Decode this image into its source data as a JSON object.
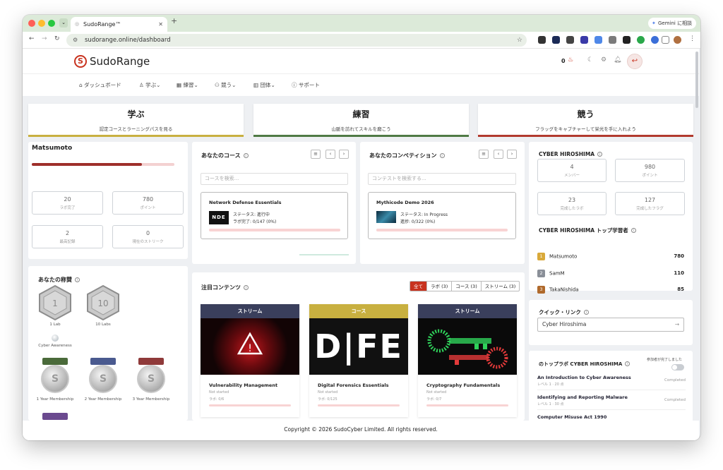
{
  "browser": {
    "tab_title": "SudoRange™",
    "url": "sudorange.online/dashboard",
    "gemini_button": "Gemini に相談"
  },
  "site": {
    "logo_text": "SudoRange",
    "streak_count": "0"
  },
  "nav": {
    "dashboard": "ダッシュボード",
    "learn": "学ぶ",
    "practice": "練習",
    "compete": "競う",
    "team": "団体",
    "support": "サポート"
  },
  "hero": [
    {
      "title": "学ぶ",
      "subtitle": "認定コースとラーニングパスを見る",
      "color": "#c8b040"
    },
    {
      "title": "練習",
      "subtitle": "山脈を訪れてスキルを磨こう",
      "color": "#4f7a45"
    },
    {
      "title": "競う",
      "subtitle": "フラッグをキャプチャーして栄光を手に入れよう",
      "color": "#b23a2e"
    }
  ],
  "profile": {
    "name": "Matsumoto",
    "level_progress": 0.77,
    "stats": [
      {
        "value": "20",
        "label": "ラボ完了"
      },
      {
        "value": "780",
        "label": "ポイント"
      },
      {
        "value": "2",
        "label": "最高記録"
      },
      {
        "value": "0",
        "label": "現在のストリーク"
      }
    ]
  },
  "courses": {
    "title": "あなたのコース",
    "search_placeholder": "コースを検索...",
    "item": {
      "name": "Network Defense Essentials",
      "logo_text": "NDE",
      "status": "ステータス: 進行中",
      "labs": "ラボ完了: 0/147 (0%)",
      "progress": 0
    }
  },
  "competitions": {
    "title": "あなたのコンペティション",
    "search_placeholder": "コンテストを検索する...",
    "item": {
      "name": "Mythicode Demo 2026",
      "status": "ステータス: In Progress",
      "progress_text": "進捗: 0/322 (0%)",
      "progress": 0
    }
  },
  "team": {
    "name": "CYBER HIROSHIMA",
    "stats": [
      {
        "value": "4",
        "label": "メンバー"
      },
      {
        "value": "980",
        "label": "ポイント"
      },
      {
        "value": "23",
        "label": "完成したラボ"
      },
      {
        "value": "127",
        "label": "完成したフラグ"
      }
    ],
    "leaderboard_title": "CYBER HIROSHIMA トップ学習者",
    "leaders": [
      {
        "rank": "1",
        "name": "Matsumoto",
        "points": "780",
        "color": "#d9a93a"
      },
      {
        "rank": "2",
        "name": "SamM",
        "points": "110",
        "color": "#8a8f98"
      },
      {
        "rank": "3",
        "name": "TakaNishida",
        "points": "85",
        "color": "#b06a2c"
      }
    ]
  },
  "achievements": {
    "title": "あなたの称賛",
    "badges": [
      {
        "label": "1 Lab",
        "icon_text": "1"
      },
      {
        "label": "10 Labs",
        "icon_text": "10"
      },
      {
        "label": "Cyber Awareness",
        "icon_text": ""
      },
      {
        "label": "1 Year Membership",
        "icon_text": "S"
      },
      {
        "label": "2 Year Membership",
        "icon_text": "S"
      },
      {
        "label": "3 Year Membership",
        "icon_text": "S"
      }
    ]
  },
  "featured": {
    "title": "注目コンテンツ",
    "filters": [
      "全て",
      "ラボ (3)",
      "コース (3)",
      "ストリーム (3)"
    ],
    "items": [
      {
        "type": "ストリーム",
        "name": "Vulnerability Management",
        "status": "Not started",
        "labs": "ラボ: 0/6",
        "color": "#3a3f5c"
      },
      {
        "type": "コース",
        "name": "Digital Forensics Essentials",
        "status": "Not started",
        "labs": "ラボ: 0/125",
        "color": "#c8b040",
        "image_text": "D|FE"
      },
      {
        "type": "ストリーム",
        "name": "Cryptography Fundamentals",
        "status": "Not started",
        "labs": "ラボ: 0/7",
        "color": "#3a3f5c"
      }
    ]
  },
  "quick_links": {
    "title": "クイック・リンク",
    "link": "Cyber Hiroshima"
  },
  "top_labs": {
    "title": "のトップラボ CYBER HIROSHIMA",
    "toggle_label": "参加者が完了しました",
    "items": [
      {
        "name": "An Introduction to Cyber Awareness",
        "points": "レベル 1 · 20 点",
        "status": "Completed"
      },
      {
        "name": "Identifying and Reporting Malware",
        "points": "レベル 1 · 30 点",
        "status": "Completed"
      },
      {
        "name": "Computer Misuse Act 1990",
        "points": "",
        "status": ""
      }
    ]
  },
  "footer": {
    "copyright": "Copyright © 2026 SudoCyber Limited. All rights reserved."
  },
  "colors": {
    "brand_red": "#c8321e",
    "progress_red": "#9e2e2a"
  }
}
